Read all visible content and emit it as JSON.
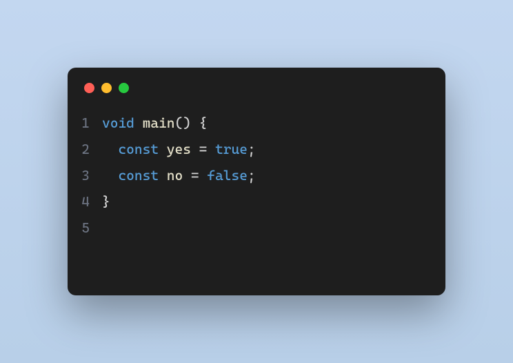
{
  "traffic_lights": {
    "close_color": "#ff5f56",
    "minimize_color": "#ffbd2e",
    "zoom_color": "#27c93f"
  },
  "code": {
    "lines": [
      {
        "n": "1",
        "indent": "",
        "t1_kw": "void",
        "t1_sp": " ",
        "t2_id": "main",
        "t3_p": "()",
        "t3_sp": " ",
        "t4_p": "{"
      },
      {
        "n": "2",
        "indent": "  ",
        "t1_kw": "const",
        "t1_sp": " ",
        "t2_id": "yes",
        "t2_sp": " ",
        "t3_p": "=",
        "t3_sp": " ",
        "t4_lit": "true",
        "t5_p": ";"
      },
      {
        "n": "3",
        "indent": "  ",
        "t1_kw": "const",
        "t1_sp": " ",
        "t2_id": "no",
        "t2_sp": " ",
        "t3_p": "=",
        "t3_sp": " ",
        "t4_lit": "false",
        "t5_p": ";"
      },
      {
        "n": "4",
        "indent": "",
        "t1_p": "}"
      },
      {
        "n": "5",
        "indent": ""
      }
    ]
  }
}
